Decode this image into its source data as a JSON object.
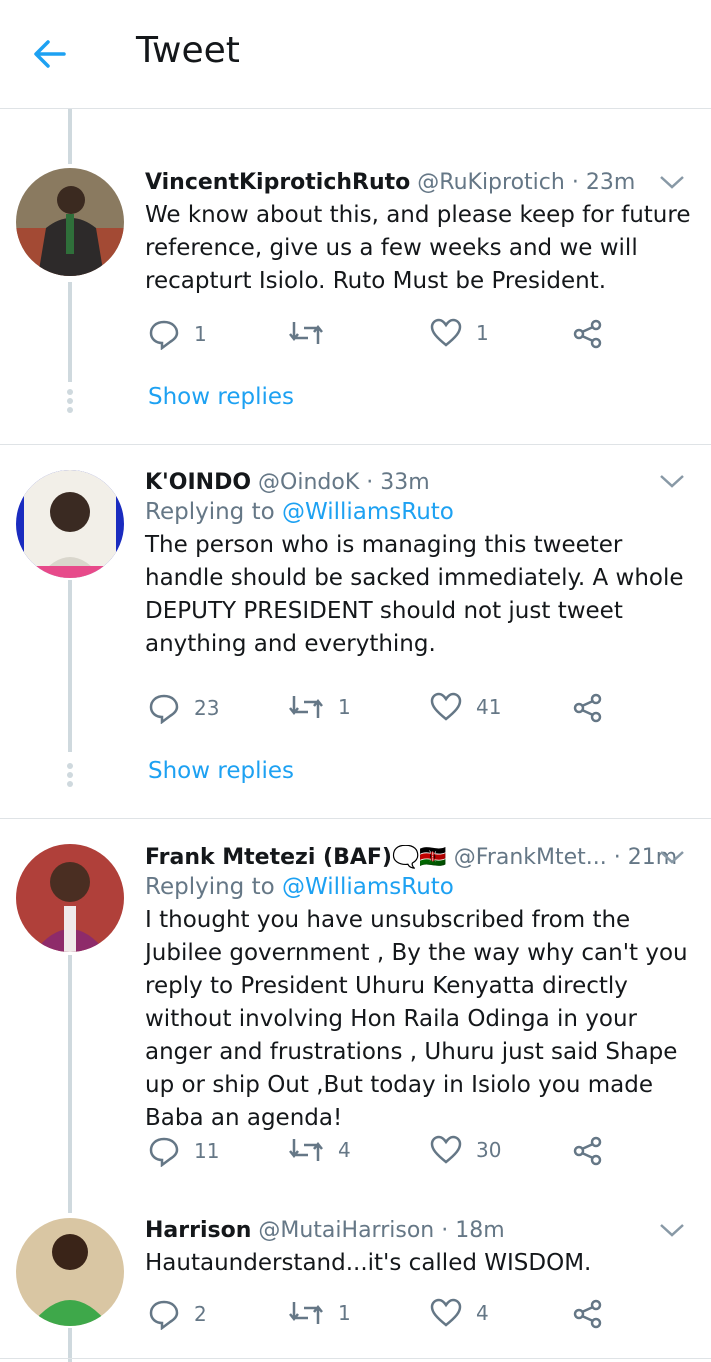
{
  "header": {
    "title": "Tweet"
  },
  "tweets": [
    {
      "name": "VincentKiprotichRuto",
      "handle": "@RuKiprotich",
      "time": "23m",
      "replying_prefix": "",
      "replying_to": "",
      "text": "We know about this, and please keep for future reference, give us a few weeks and we will recapturt Isiolo. Ruto Must be President.",
      "replies": "1",
      "retweets": "",
      "likes": "1",
      "show_replies": "Show replies",
      "avatar_colors": [
        "#7a6a55",
        "#2e3a2a"
      ]
    },
    {
      "name": "K'OINDO",
      "handle": "@OindoK",
      "time": "33m",
      "replying_prefix": "Replying to",
      "replying_to": "@WilliamsRuto",
      "text": "The person who is managing this tweeter handle should be sacked immediately. A whole DEPUTY PRESIDENT should not just tweet anything and everything.",
      "replies": "23",
      "retweets": "1",
      "likes": "41",
      "show_replies": "Show replies",
      "avatar_colors": [
        "#1a2bbf",
        "#f2efe8"
      ]
    },
    {
      "name": "Frank Mtetezi (BAF)🗨️🇰🇪",
      "handle": "@FrankMtet...",
      "time": "21m",
      "replying_prefix": "Replying to",
      "replying_to": "@WilliamsRuto",
      "text": "I thought you have unsubscribed from the Jubilee government , By the way why can't you reply to President Uhuru Kenyatta directly without involving Hon Raila Odinga in your anger and frustrations , Uhuru just said Shape up or ship Out ,But today in Isiolo you made Baba an agenda!",
      "replies": "11",
      "retweets": "4",
      "likes": "30",
      "show_replies": "",
      "avatar_colors": [
        "#b0403a",
        "#8e2b6a"
      ]
    },
    {
      "name": "Harrison",
      "handle": "@MutaiHarrison",
      "time": "18m",
      "replying_prefix": "",
      "replying_to": "",
      "text": "Hautaunderstand...it's called WISDOM.",
      "replies": "2",
      "retweets": "1",
      "likes": "4",
      "show_replies": "",
      "avatar_colors": [
        "#3ea84a",
        "#d9c6a3"
      ]
    }
  ],
  "colors": {
    "accent": "#1da1f2",
    "muted": "#657786",
    "thread": "#cfd9de"
  }
}
